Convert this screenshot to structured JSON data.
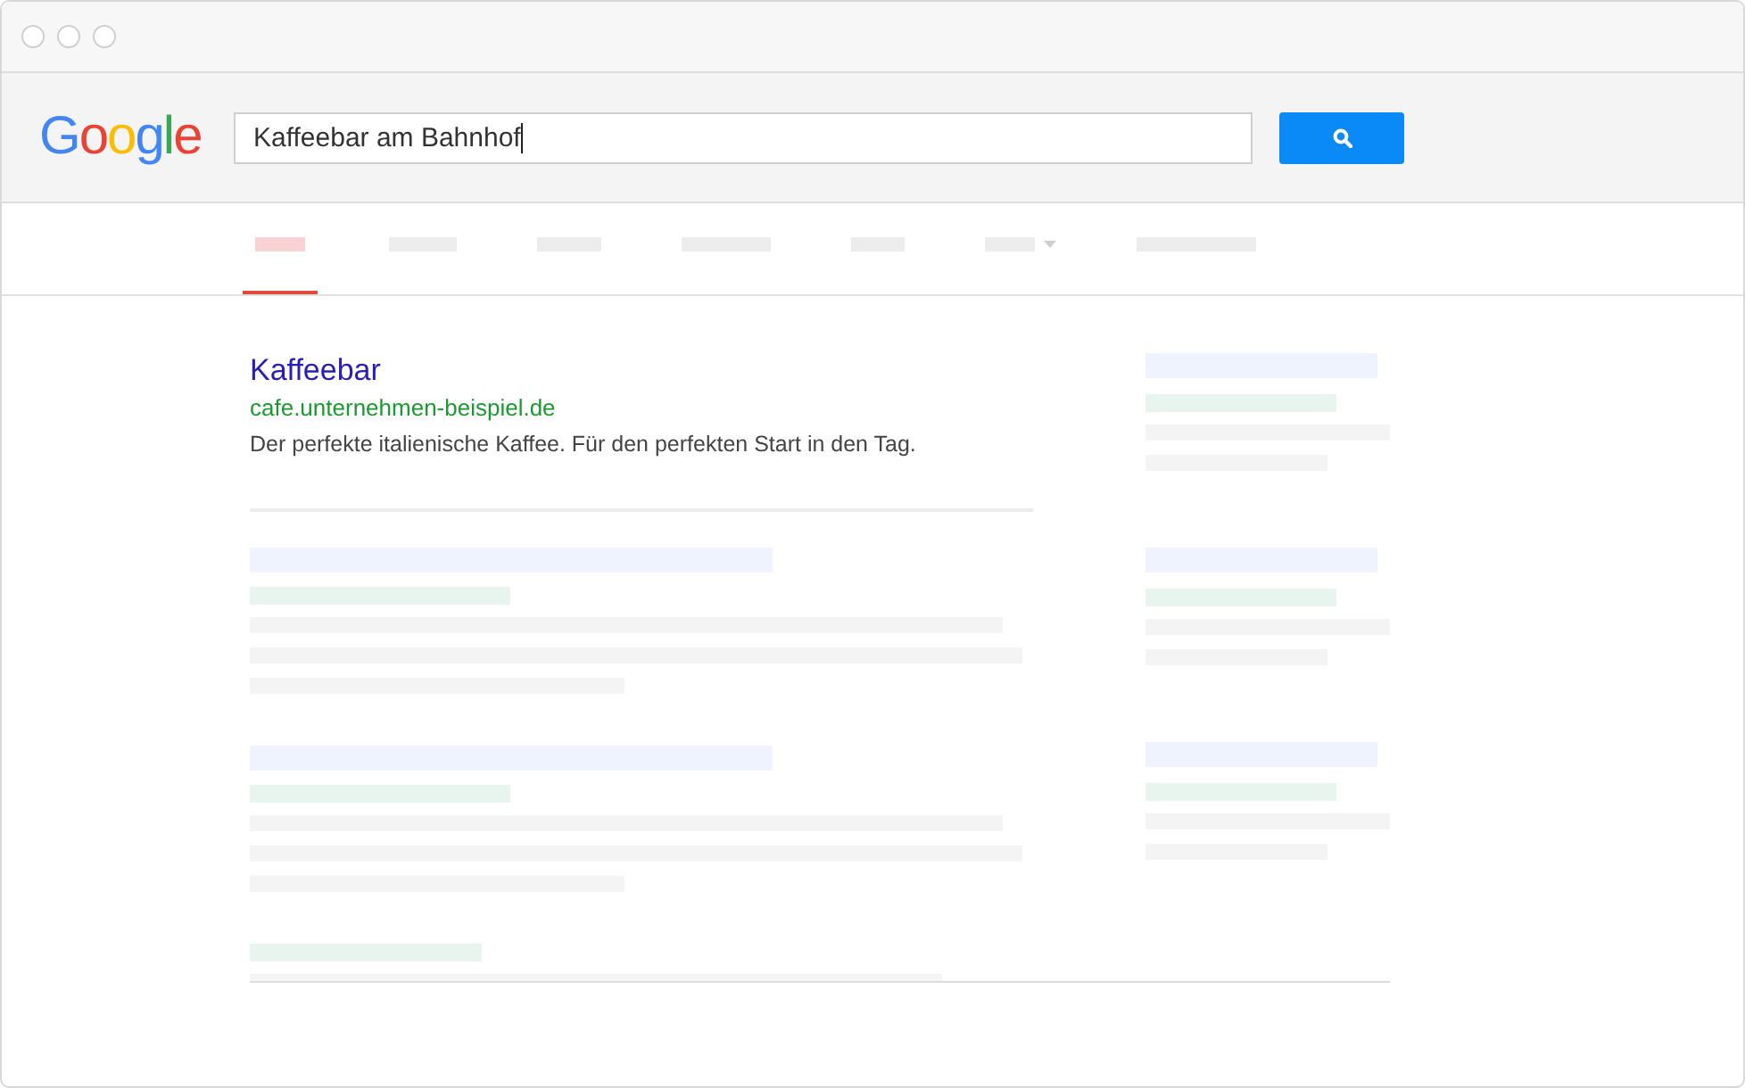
{
  "logo": "Google",
  "search": {
    "value": "Kaffeebar am Bahnhof"
  },
  "tabs": [
    {
      "kind": "plain",
      "selected": true
    },
    {
      "kind": "plain",
      "selected": false
    },
    {
      "kind": "plain",
      "selected": false
    },
    {
      "kind": "plain",
      "selected": false
    },
    {
      "kind": "plain",
      "selected": false
    },
    {
      "kind": "dropdown",
      "selected": false
    },
    {
      "kind": "plain",
      "selected": false
    }
  ],
  "result": {
    "title": "Kaffeebar",
    "url": "cafe.unternehmen-beispiel.de",
    "snippet": "Der perfekte italienische Kaffee. Für den perfekten Start in den Tag."
  }
}
